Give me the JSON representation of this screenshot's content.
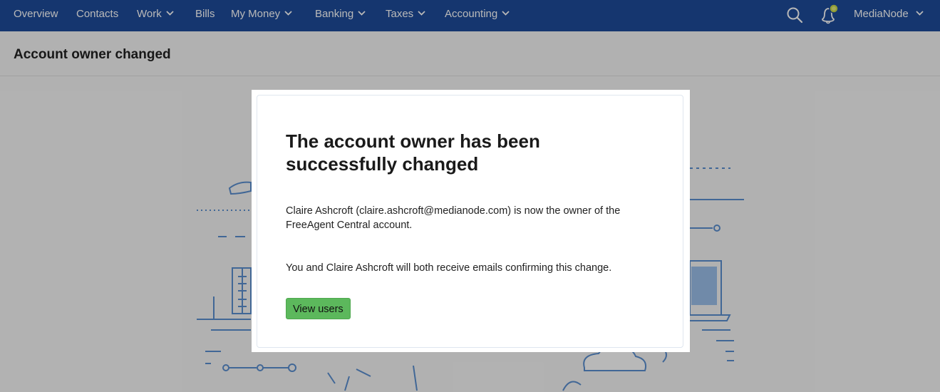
{
  "nav": {
    "items": [
      {
        "label": "Overview"
      },
      {
        "label": "Contacts"
      },
      {
        "label": "Work"
      },
      {
        "label": "Bills"
      },
      {
        "label": "My Money"
      },
      {
        "label": "Banking"
      },
      {
        "label": "Taxes"
      },
      {
        "label": "Accounting"
      }
    ],
    "company": "MediaNode",
    "icons": {
      "search": "search-icon",
      "notifications": "bell-icon"
    }
  },
  "page": {
    "title": "Account owner changed"
  },
  "modal": {
    "heading": "The account owner has been successfully changed",
    "paragraph1": "Claire Ashcroft (claire.ashcroft@medianode.com) is now the owner of the FreeAgent Central account.",
    "paragraph2": "You and Claire Ashcroft will both receive emails confirming this change.",
    "button_label": "View users"
  },
  "colors": {
    "nav_bg": "#1e4c9a",
    "button_bg": "#5cb85c",
    "notification_dot": "#c8d84a"
  }
}
